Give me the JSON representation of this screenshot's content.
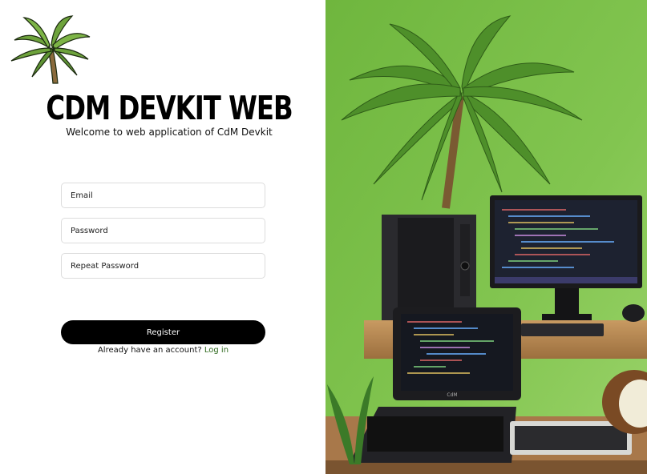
{
  "app": {
    "title": "CDM DEVKIT WEB",
    "subtitle": "Welcome to web application of CdM Devkit"
  },
  "form": {
    "email_placeholder": "Email",
    "password_placeholder": "Password",
    "repeat_password_placeholder": "Repeat Password",
    "register_label": "Register",
    "login_prompt": "Already have an account?",
    "login_link_label": "Log in"
  },
  "illustration": {
    "brand_label": "CdM"
  },
  "colors": {
    "background_green": "#7fc04a",
    "button_black": "#000000",
    "link_green": "#2f6a1e"
  }
}
